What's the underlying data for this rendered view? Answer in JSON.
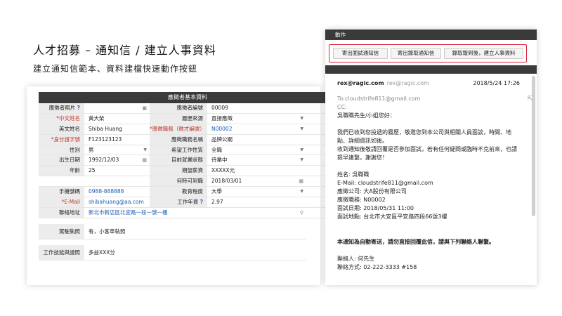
{
  "heading": {
    "title": "人才招募 – 通知信 / 建立人事資料",
    "subtitle": "建立通知信範本、資料建檔快速動作按鈕"
  },
  "form": {
    "header": "應徵者基本資料",
    "rows": [
      {
        "l1": "應徵者照片",
        "v1": "",
        "l2": "應徵者編號",
        "v2": "00009"
      },
      {
        "l1": "*中文姓名",
        "v1": "黃大柴",
        "l2": "履歷來源",
        "v2": "直接應徵"
      },
      {
        "l1": "英文姓名",
        "v1": "Shiba Huang",
        "l2": "*應徵職務（徵才編號）",
        "v2": "N00002"
      },
      {
        "l1": "*身分證字號",
        "v1": "F123123123",
        "l2": "應徵職務名稱",
        "v2": "品牌公關"
      },
      {
        "l1": "性別",
        "v1": "男",
        "l2": "希望工作性質",
        "v2": "全職"
      },
      {
        "l1": "出生日期",
        "v1": "1992/12/03",
        "l2": "目前就業狀態",
        "v2": "待業中"
      },
      {
        "l1": "年齡",
        "v1": "25",
        "l2": "期望薪資",
        "v2": "XXXXX元"
      },
      {
        "l1": "",
        "v1": "",
        "l2": "何時可到職",
        "v2": "2018/03/01"
      },
      {
        "l1": "手機號碼",
        "v1": "0988-888888",
        "l2": "教育程度",
        "v2": "大學"
      },
      {
        "l1": "*E-Mail",
        "v1": "shibahuang@aa.com",
        "l2": "工作年資",
        "v2": "2.97"
      }
    ],
    "address_label": "聯絡地址",
    "address_value": "新北市新店區北宜路一段一號一樓",
    "license_label": "駕駛執照",
    "license_value": "有，小客車執照",
    "skills_label": "工作技能與證照",
    "skills_value": "多益XXX分"
  },
  "mail": {
    "action_label": "動作",
    "buttons": [
      "寄出面試通知信",
      "寄出錄取通知信",
      "錄取報到後，建立人事資料"
    ],
    "from": "rex@ragic.com",
    "from_sub": "rex@ragic.com",
    "date": "2018/5/24 17:26",
    "to": "To:cloudstrife811@gmail.com",
    "cc": "CC:",
    "greeting": "吳職職先生/小姐您好：",
    "body1": "我們已收到您投遞的履歷，敬邀您到本公司與相關人員面談，時間、地點、詳細資訊如後。",
    "body2": "收到通知後敬請回覆是否參加面試，若有任何疑問或臨時不克前來，也請提早連繫。謝謝您！",
    "info": [
      "姓名: 吳職職",
      "E-Mail: cloudstrife811@gmail.com",
      "應徵公司: 大A股份有限公司",
      "應徵職務: N00002",
      "面試日期: 2018/05/31 11:00",
      "面試地點: 台北市大安區平安路四段66號3樓"
    ],
    "notice": "本通知為自動寄送，請勿直接回覆此信，請與下列聯絡人聯繫。",
    "contact": "聯絡人: 何先生",
    "contact_phone": "聯絡方式: 02-222-3333 #158"
  },
  "colors": {
    "dark_bar": "#3a3a3a",
    "highlight_border": "#e0203a",
    "link": "#1a5fb4",
    "required": "#c0392b"
  }
}
